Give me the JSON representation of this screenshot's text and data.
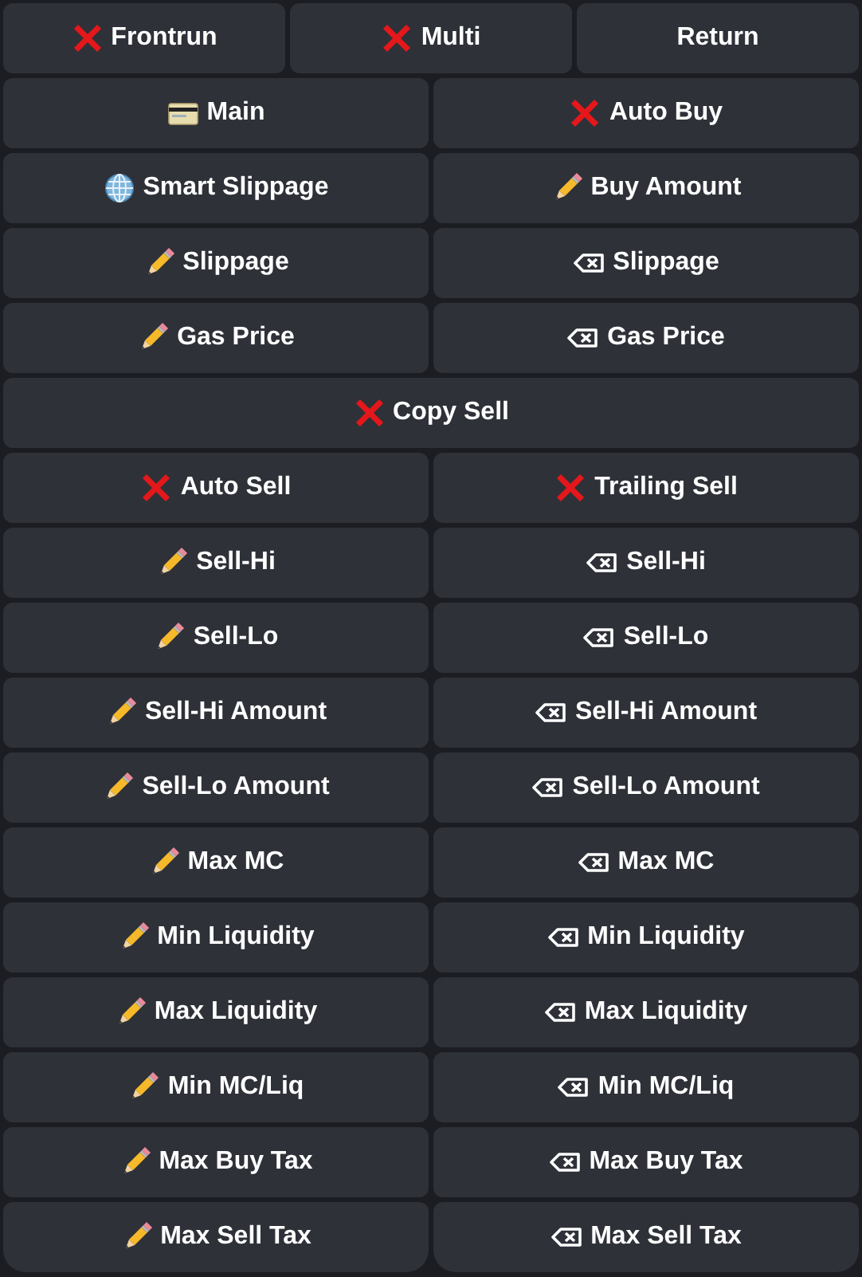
{
  "keyboard": {
    "rows": [
      {
        "buttons": [
          {
            "label": "Frontrun",
            "kind": "cross"
          },
          {
            "label": "Multi",
            "kind": "cross"
          },
          {
            "label": "Return"
          }
        ]
      },
      {
        "buttons": [
          {
            "label": "Main",
            "kind": "card"
          },
          {
            "label": "Auto Buy",
            "kind": "cross"
          }
        ]
      },
      {
        "buttons": [
          {
            "label": "Smart Slippage",
            "kind": "globe"
          },
          {
            "label": "Buy Amount",
            "kind": "pencil"
          }
        ]
      },
      {
        "buttons": [
          {
            "label": "Slippage",
            "kind": "pencil"
          },
          {
            "label": "Slippage",
            "kind": "erase"
          }
        ]
      },
      {
        "buttons": [
          {
            "label": "Gas Price",
            "kind": "pencil"
          },
          {
            "label": "Gas Price",
            "kind": "erase"
          }
        ]
      },
      {
        "buttons": [
          {
            "label": "Copy Sell",
            "kind": "cross"
          }
        ]
      },
      {
        "buttons": [
          {
            "label": "Auto Sell",
            "kind": "cross"
          },
          {
            "label": "Trailing Sell",
            "kind": "cross"
          }
        ]
      },
      {
        "buttons": [
          {
            "label": "Sell-Hi",
            "kind": "pencil"
          },
          {
            "label": "Sell-Hi",
            "kind": "erase"
          }
        ]
      },
      {
        "buttons": [
          {
            "label": "Sell-Lo",
            "kind": "pencil"
          },
          {
            "label": "Sell-Lo",
            "kind": "erase"
          }
        ]
      },
      {
        "buttons": [
          {
            "label": "Sell-Hi Amount",
            "kind": "pencil"
          },
          {
            "label": "Sell-Hi Amount",
            "kind": "erase"
          }
        ]
      },
      {
        "buttons": [
          {
            "label": "Sell-Lo Amount",
            "kind": "pencil"
          },
          {
            "label": "Sell-Lo Amount",
            "kind": "erase"
          }
        ]
      },
      {
        "buttons": [
          {
            "label": "Max MC",
            "kind": "pencil"
          },
          {
            "label": "Max MC",
            "kind": "erase"
          }
        ]
      },
      {
        "buttons": [
          {
            "label": "Min Liquidity",
            "kind": "pencil"
          },
          {
            "label": "Min Liquidity",
            "kind": "erase"
          }
        ]
      },
      {
        "buttons": [
          {
            "label": "Max Liquidity",
            "kind": "pencil"
          },
          {
            "label": "Max Liquidity",
            "kind": "erase"
          }
        ]
      },
      {
        "buttons": [
          {
            "label": "Min MC/Liq",
            "kind": "pencil"
          },
          {
            "label": "Min MC/Liq",
            "kind": "erase"
          }
        ]
      },
      {
        "buttons": [
          {
            "label": "Max Buy Tax",
            "kind": "pencil"
          },
          {
            "label": "Max Buy Tax",
            "kind": "erase"
          }
        ]
      },
      {
        "buttons": [
          {
            "label": "Max Sell Tax",
            "kind": "pencil"
          },
          {
            "label": "Max Sell Tax",
            "kind": "erase"
          }
        ]
      }
    ]
  }
}
